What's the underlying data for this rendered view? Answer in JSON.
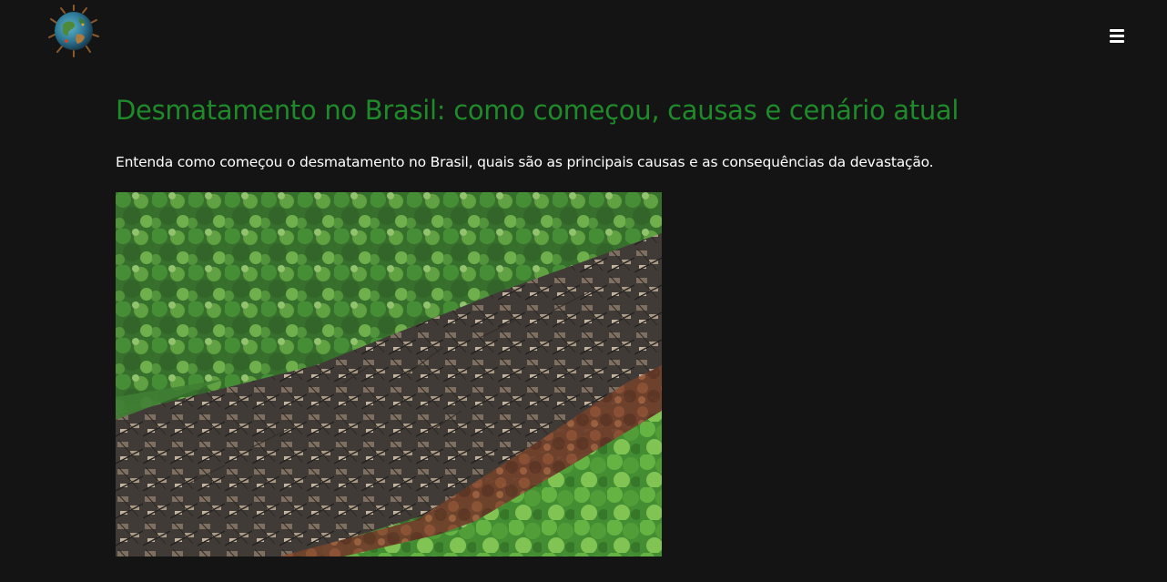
{
  "header": {
    "logo_icon": "globe-logo-icon",
    "menu_icon": "hamburger-menu-icon"
  },
  "article": {
    "title": "Desmatamento no Brasil: como começou, causas e cenário atual",
    "subtitle": "Entenda como começou o desmatamento no Brasil, quais são as principais causas e as consequências da devastação.",
    "image_subject": "aerial-deforestation-photo"
  },
  "colors": {
    "background": "#141414",
    "title": "#1f8a2a",
    "text": "#ffffff"
  }
}
